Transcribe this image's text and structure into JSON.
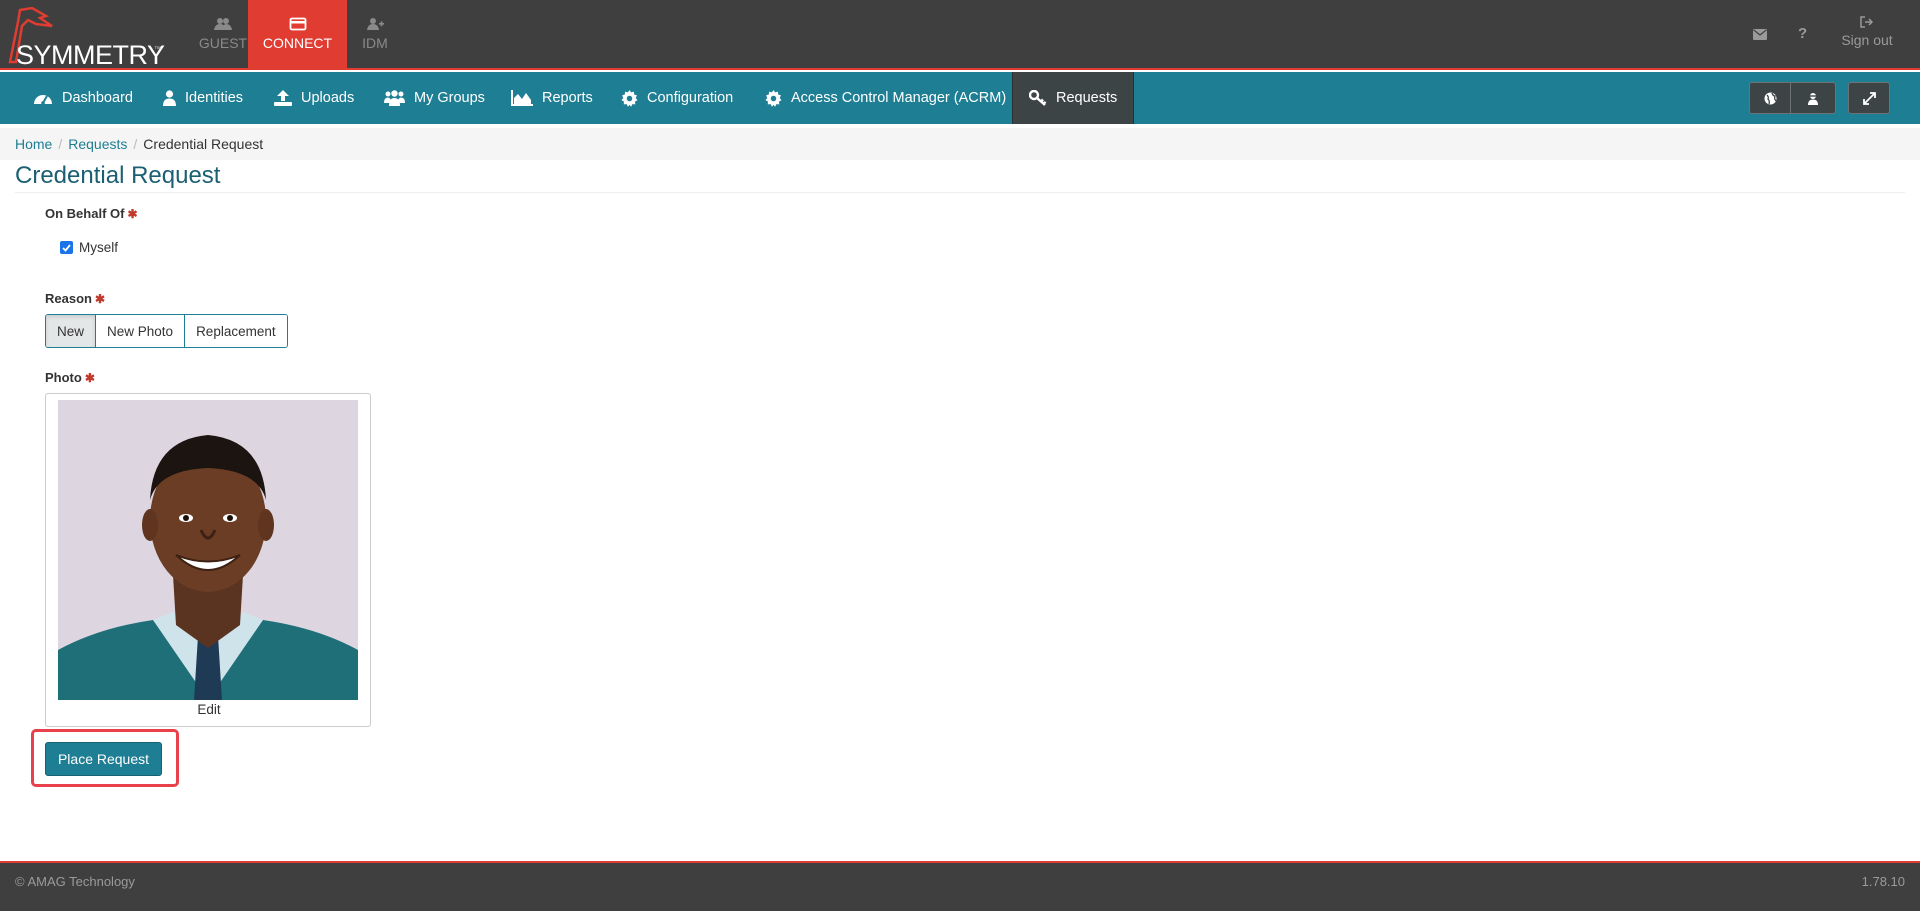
{
  "brand": {
    "name": "SYMMETRY",
    "trademark": "™",
    "accent": "#e03c31"
  },
  "app_tabs": [
    {
      "label": "GUEST",
      "icon": "users-icon",
      "active": false
    },
    {
      "label": "CONNECT",
      "icon": "credit-card-icon",
      "active": true
    },
    {
      "label": "IDM",
      "icon": "user-plus-icon",
      "active": false
    }
  ],
  "top_right": {
    "mail_icon": "envelope-icon",
    "help_label": "?",
    "signout_label": "Sign out"
  },
  "nav": {
    "items": [
      {
        "label": "Dashboard",
        "icon": "dashboard-icon"
      },
      {
        "label": "Identities",
        "icon": "user-icon"
      },
      {
        "label": "Uploads",
        "icon": "upload-icon"
      },
      {
        "label": "My Groups",
        "icon": "group-icon"
      },
      {
        "label": "Reports",
        "icon": "area-chart-icon"
      },
      {
        "label": "Configuration",
        "icon": "cog-icon"
      },
      {
        "label": "Access Control Manager (ACRM)",
        "icon": "cog-icon"
      },
      {
        "label": "Requests",
        "icon": "key-icon",
        "active": true
      }
    ],
    "color": "#1e7e93"
  },
  "breadcrumb": {
    "home": "Home",
    "requests": "Requests",
    "current": "Credential Request"
  },
  "page": {
    "title": "Credential Request",
    "on_behalf_label": "On Behalf Of",
    "myself_label": "Myself",
    "myself_checked": true,
    "reason_label": "Reason",
    "reason_options": [
      "New",
      "New Photo",
      "Replacement"
    ],
    "reason_selected": "New",
    "photo_label": "Photo",
    "edit_label": "Edit",
    "submit_label": "Place Request",
    "required_marker": "✱"
  },
  "footer": {
    "copyright": "© AMAG Technology",
    "version": "1.78.10"
  }
}
